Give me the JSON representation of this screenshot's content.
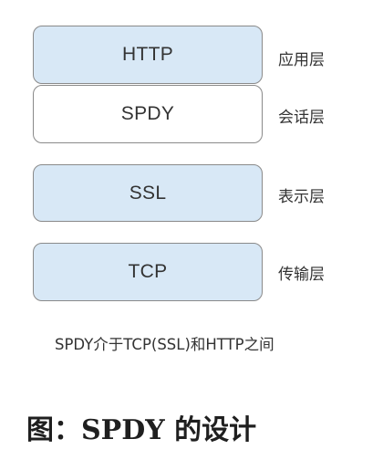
{
  "diagram": {
    "layers": [
      {
        "name": "HTTP",
        "layer_label": "应用层",
        "color": "#d8e8f6"
      },
      {
        "name": "SPDY",
        "layer_label": "会话层",
        "color": "#ffffff"
      },
      {
        "name": "SSL",
        "layer_label": "表示层",
        "color": "#d8e8f6"
      },
      {
        "name": "TCP",
        "layer_label": "传输层",
        "color": "#d8e8f6"
      }
    ],
    "note": "SPDY介于TCP(SSL)和HTTP之间"
  },
  "caption": "图：SPDY 的设计",
  "colors": {
    "box_fill": "#d8e8f6",
    "box_border": "#8a8a8a",
    "text": "#333333"
  }
}
